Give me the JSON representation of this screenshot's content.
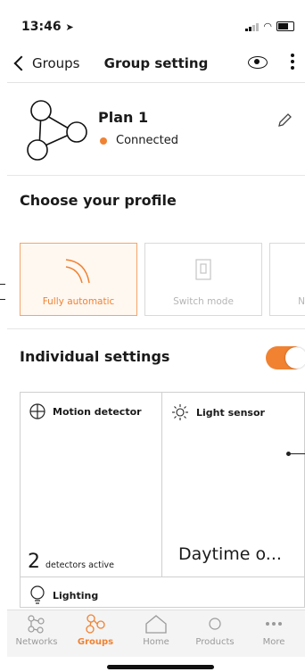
{
  "status_bar": {
    "time": "13:46"
  },
  "nav": {
    "back_label": "Groups",
    "title": "Group setting"
  },
  "group": {
    "name": "Plan 1",
    "status": "Connected",
    "status_color": "#f08232"
  },
  "profile_section": {
    "title": "Choose your profile",
    "profiles": [
      {
        "label": "Fully automatic",
        "selected": true
      },
      {
        "label": "Switch mode",
        "selected": false
      },
      {
        "label": "N",
        "selected": false
      }
    ]
  },
  "individual": {
    "title": "Individual settings",
    "enabled": true,
    "cells": {
      "motion": {
        "title": "Motion detector",
        "count": "2",
        "count_label": "detectors active"
      },
      "light": {
        "title": "Light sensor",
        "value": "Daytime o..."
      },
      "lighting": {
        "title": "Lighting"
      }
    }
  },
  "tabbar": {
    "tabs": [
      {
        "label": "Networks",
        "icon": "networks-icon"
      },
      {
        "label": "Groups",
        "icon": "groups-icon",
        "active": true
      },
      {
        "label": "Home",
        "icon": "home-icon"
      },
      {
        "label": "Products",
        "icon": "products-icon"
      },
      {
        "label": "More",
        "icon": "more-icon"
      }
    ]
  },
  "colors": {
    "accent": "#f08232",
    "inactive": "#9a9a9a"
  }
}
